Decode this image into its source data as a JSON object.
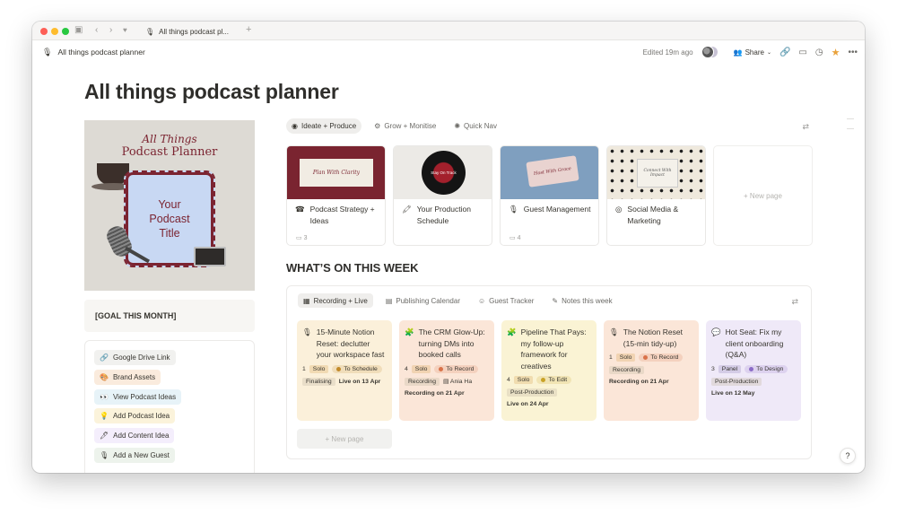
{
  "browser": {
    "tab_title": "All things podcast pl...",
    "new_tab": "+"
  },
  "topbar": {
    "breadcrumb": "All things podcast planner",
    "edited": "Edited 19m ago",
    "share_label": "Share"
  },
  "page": {
    "title": "All things podcast planner",
    "goal": "[GOAL THIS MONTH]"
  },
  "cover": {
    "line1": "All Things",
    "line2": "Podcast Planner",
    "frame_lines": [
      "Your",
      "Podcast",
      "Title"
    ]
  },
  "links": [
    {
      "label": "Google Drive Link",
      "icon": "🔗",
      "bg": "#f1f1ef"
    },
    {
      "label": "Brand Assets",
      "icon": "🎨",
      "bg": "#faebdd"
    },
    {
      "label": "View Podcast Ideas",
      "icon": "👀",
      "bg": "#e7f3f8"
    },
    {
      "label": "Add Podcast Idea",
      "icon": "💡",
      "bg": "#fbf3db"
    },
    {
      "label": "Add Content Idea",
      "icon": "🖊",
      "bg": "#f4eefc"
    },
    {
      "label": "Add a New Guest",
      "icon": "🎙",
      "bg": "#edf3ec"
    }
  ],
  "gallery_views": [
    {
      "label": "Ideate + Produce",
      "icon": "◉",
      "active": true
    },
    {
      "label": "Grow + Monitise",
      "icon": "⚙",
      "active": false
    },
    {
      "label": "Quick Nav",
      "icon": "✺",
      "active": false
    }
  ],
  "gallery": [
    {
      "title": "Podcast Strategy + Ideas",
      "icon": "☎",
      "count": "3",
      "img_text": "Plan With Clarity"
    },
    {
      "title": "Your Production Schedule",
      "icon": "🖍",
      "count": "",
      "img_text": "Stay On Track"
    },
    {
      "title": "Guest Management",
      "icon": "🎙",
      "count": "4",
      "img_text": "Host With Grace"
    },
    {
      "title": "Social Media & Marketing",
      "icon": "◎",
      "count": "",
      "img_text": "Connect With Impact"
    }
  ],
  "new_page": "+ New page",
  "section": {
    "heading": "WHAT’S ON THIS WEEK"
  },
  "board_views": [
    {
      "label": "Recording + Live",
      "icon": "▦",
      "active": true
    },
    {
      "label": "Publishing Calendar",
      "icon": "▤",
      "active": false
    },
    {
      "label": "Guest Tracker",
      "icon": "☺",
      "active": false
    },
    {
      "label": "Notes this week",
      "icon": "✎",
      "active": false
    }
  ],
  "episodes": [
    {
      "icon": "🎙",
      "title": "15-Minute Notion Reset: declutter your workspace fast",
      "num": "1",
      "type": "Solo",
      "status": "To Schedule",
      "status_color": "#c28a2a",
      "stage": "Finalising",
      "date": "Live on 13 Apr",
      "bg": "#fbf0da"
    },
    {
      "icon": "🧩",
      "title": "The CRM Glow-Up: turning DMs into booked calls",
      "num": "4",
      "type": "Solo",
      "status": "To Record",
      "status_color": "#d9734a",
      "stage": "Recording",
      "guest": "Ania Ha",
      "date": "Recording on 21 Apr",
      "bg": "#fbe6d8"
    },
    {
      "icon": "🧩",
      "title": "Pipeline That Pays: my follow-up framework for creatives",
      "num": "4",
      "type": "Solo",
      "status": "To Edit",
      "status_color": "#c9a227",
      "stage": "Post-Production",
      "date": "Live on 24 Apr",
      "bg": "#faf3d4"
    },
    {
      "icon": "🎙",
      "title": "The Notion Reset (15-min tidy-up)",
      "num": "1",
      "type": "Solo",
      "status": "To Record",
      "status_color": "#d9734a",
      "stage": "Recording",
      "date": "Recording on 21 Apr",
      "bg": "#fbe6d8"
    },
    {
      "icon": "💬",
      "title": "Hot Seat: Fix my client onboarding (Q&A)",
      "num": "3",
      "type": "Panel",
      "status": "To Design",
      "status_color": "#8b6cc7",
      "stage": "Post-Production",
      "date": "Live on 12 May",
      "bg": "#efe9f8"
    }
  ],
  "board_new_page": "+ New page",
  "help_label": "?"
}
